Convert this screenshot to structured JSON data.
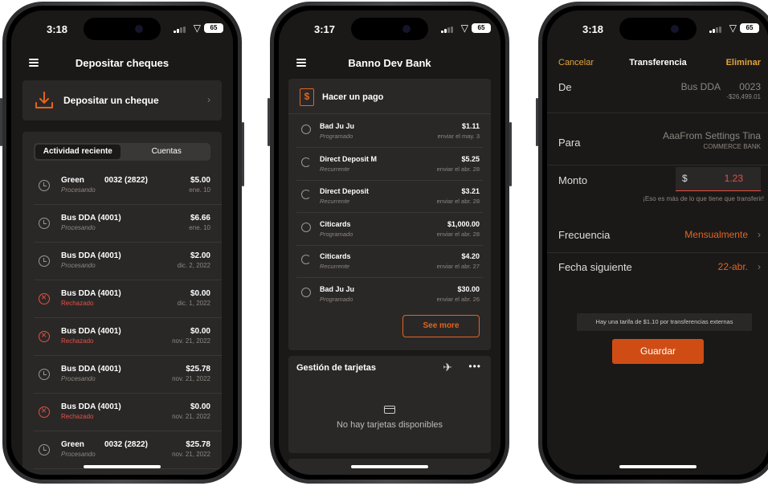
{
  "status": {
    "phone1_time": "3:18",
    "phone2_time": "3:17",
    "phone3_time": "3:18",
    "battery": "65"
  },
  "phone1": {
    "title": "Depositar cheques",
    "deposit_label": "Depositar un cheque",
    "segments": [
      "Actividad reciente",
      "Cuentas"
    ],
    "rows": [
      {
        "name": "Green",
        "account": "0032 (2822)",
        "status": "Procesando",
        "amount": "$5.00",
        "date": "ene. 10",
        "rejected": false
      },
      {
        "name": "Bus DDA (4001)",
        "account": "",
        "status": "Procesando",
        "amount": "$6.66",
        "date": "ene. 10",
        "rejected": false
      },
      {
        "name": "Bus DDA (4001)",
        "account": "",
        "status": "Procesando",
        "amount": "$2.00",
        "date": "dic. 2, 2022",
        "rejected": false
      },
      {
        "name": "Bus DDA (4001)",
        "account": "",
        "status": "Rechazado",
        "amount": "$0.00",
        "date": "dic. 1, 2022",
        "rejected": true
      },
      {
        "name": "Bus DDA (4001)",
        "account": "",
        "status": "Rechazado",
        "amount": "$0.00",
        "date": "nov. 21, 2022",
        "rejected": true
      },
      {
        "name": "Bus DDA (4001)",
        "account": "",
        "status": "Procesando",
        "amount": "$25.78",
        "date": "nov. 21, 2022",
        "rejected": false
      },
      {
        "name": "Bus DDA (4001)",
        "account": "",
        "status": "Rechazado",
        "amount": "$0.00",
        "date": "nov. 21, 2022",
        "rejected": true
      },
      {
        "name": "Green",
        "account": "0032 (2822)",
        "status": "Procesando",
        "amount": "$25.78",
        "date": "nov. 21, 2022",
        "rejected": false
      }
    ]
  },
  "phone2": {
    "title": "Banno Dev Bank",
    "pay_label": "Hacer un pago",
    "pay_icon": "$",
    "payments": [
      {
        "name": "Bad Ju Ju",
        "status": "Programado",
        "amount": "$1.11",
        "date": "enviar el may. 3",
        "recurring": false
      },
      {
        "name": "Direct Deposit M",
        "status": "Recurrente",
        "amount": "$5.25",
        "date": "enviar el abr. 28",
        "recurring": true
      },
      {
        "name": "Direct Deposit",
        "status": "Recurrente",
        "amount": "$3.21",
        "date": "enviar el abr. 28",
        "recurring": true
      },
      {
        "name": "Citicards",
        "status": "Programado",
        "amount": "$1,000.00",
        "date": "enviar el abr. 28",
        "recurring": false
      },
      {
        "name": "Citicards",
        "status": "Recurrente",
        "amount": "$4.20",
        "date": "enviar el abr. 27",
        "recurring": true
      },
      {
        "name": "Bad Ju Ju",
        "status": "Programado",
        "amount": "$30.00",
        "date": "enviar el abr. 26",
        "recurring": false
      }
    ],
    "see_more": "See more",
    "cards_title": "Gestión de tarjetas",
    "cards_more": "•••",
    "cards_empty": "No hay tarjetas disponibles"
  },
  "phone3": {
    "cancel": "Cancelar",
    "title": "Transferencia",
    "delete": "Eliminar",
    "from_label": "De",
    "from_account": "Bus DDA",
    "from_number": "0023",
    "from_balance": "-$26,499.01",
    "to_label": "Para",
    "to_account": "AaaFrom Settings Tina",
    "to_bank": "COMMERCE BANK",
    "amount_label": "Monto",
    "currency": "$",
    "amount": "1.23",
    "amount_error": "¡Eso es más de lo que tiene que transferir!",
    "freq_label": "Frecuencia",
    "freq_value": "Mensualmente",
    "next_label": "Fecha siguiente",
    "next_value": "22-abr.",
    "fee_note": "Hay una tarifa de $1.10 por transferencias externas",
    "save": "Guardar"
  },
  "colors": {
    "accent_orange": "#e2641f",
    "accent_gold": "#e2a43a",
    "error_red": "#e55045",
    "background": "#1b1918",
    "card": "#2a2827"
  }
}
